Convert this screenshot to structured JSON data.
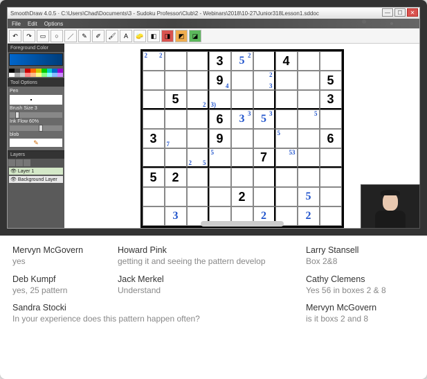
{
  "app": {
    "title": "SmoothDraw 4.0.5 · C:\\Users\\Chad\\Documents\\3 - Sudoku Professor\\Club\\2 - Webinars\\2018\\10-27\\Junior318Lesson1.sddoc",
    "menus": [
      "File",
      "Edit",
      "Options"
    ]
  },
  "window_buttons": {
    "min": "—",
    "max": "☐",
    "close": "✕"
  },
  "toolbar_icons": [
    "↶",
    "↷",
    "▭",
    "○",
    "／",
    "✎",
    "✐",
    "🖌",
    "A",
    "🧽",
    "◧",
    "◨",
    "◩",
    "◪"
  ],
  "sidepanel": {
    "foreground_label": "Foreground Color",
    "tool_options_label": "Tool Options",
    "pen_label": "Pen",
    "brush_size_label": "Brush Size",
    "brush_size_value": "3",
    "ink_flow_label": "Ink Flow",
    "ink_flow_value": "60%",
    "blob_label": "blob",
    "layers_label": "Layers",
    "layer1": "Layer 1",
    "layer_bg": "Background Layer"
  },
  "palette_colors": [
    "#000",
    "#444",
    "#888",
    "#c00",
    "#f60",
    "#cc0",
    "#0c0",
    "#0cc",
    "#06c",
    "#90c",
    "#fff",
    "#aaa",
    "#ccc",
    "#f88",
    "#fb8",
    "#ff8",
    "#8f8",
    "#8ff",
    "#8bf",
    "#c8f"
  ],
  "sudoku": {
    "givens": [
      [
        null,
        null,
        null,
        "3",
        null,
        null,
        "4",
        null,
        null
      ],
      [
        null,
        null,
        null,
        "9",
        null,
        null,
        null,
        null,
        "5"
      ],
      [
        null,
        "5",
        null,
        null,
        null,
        null,
        null,
        null,
        "3"
      ],
      [
        null,
        null,
        null,
        "6",
        null,
        null,
        null,
        null,
        null
      ],
      [
        "3",
        null,
        null,
        "9",
        null,
        null,
        null,
        null,
        "6"
      ],
      [
        null,
        null,
        null,
        null,
        null,
        "7",
        null,
        null,
        null
      ],
      [
        "5",
        "2",
        null,
        null,
        null,
        null,
        null,
        null,
        null
      ],
      [
        null,
        null,
        null,
        null,
        "2",
        null,
        null,
        null,
        null
      ],
      [
        null,
        null,
        null,
        null,
        null,
        null,
        null,
        null,
        null
      ]
    ],
    "pencils": {
      "0,0": [
        {
          "txt": "2",
          "pos": "tl"
        },
        {
          "txt": "2",
          "pos": "tr"
        }
      ],
      "0,4": [
        {
          "txt": "5",
          "pos": "c"
        },
        {
          "txt": "2",
          "pos": "tr"
        }
      ],
      "1,3": [
        {
          "txt": "4",
          "pos": "br"
        }
      ],
      "1,5": [
        {
          "txt": "2",
          "pos": "tr"
        },
        {
          "txt": "3",
          "pos": "br"
        }
      ],
      "2,2": [
        {
          "txt": "2",
          "pos": "br"
        }
      ],
      "2,3": [
        {
          "txt": "3)",
          "pos": "bl"
        }
      ],
      "3,4": [
        {
          "txt": "3",
          "pos": "c"
        },
        {
          "txt": "3",
          "pos": "tr"
        }
      ],
      "3,5": [
        {
          "txt": "5",
          "pos": "c"
        },
        {
          "txt": "3",
          "pos": "tr"
        }
      ],
      "3,7": [
        {
          "txt": "5",
          "pos": "tr"
        }
      ],
      "4,1": [
        {
          "txt": "7",
          "pos": "bl"
        }
      ],
      "4,6": [
        {
          "txt": "5",
          "pos": "tl"
        }
      ],
      "5,2": [
        {
          "txt": "5",
          "pos": "br"
        },
        {
          "txt": "2",
          "pos": "bl"
        }
      ],
      "5,6": [
        {
          "txt": "53",
          "pos": "tr"
        }
      ],
      "5,3": [
        {
          "txt": "5",
          "pos": "tl"
        }
      ],
      "7,7": [
        {
          "txt": "5",
          "pos": "c"
        }
      ],
      "8,1": [
        {
          "txt": "3",
          "pos": "c"
        }
      ],
      "8,5": [
        {
          "txt": "2",
          "pos": "c"
        }
      ],
      "8,7": [
        {
          "txt": "2",
          "pos": "c"
        }
      ]
    }
  },
  "chat": [
    {
      "name": "Mervyn McGovern",
      "msg": "yes",
      "col": 1
    },
    {
      "name": "Howard Pink",
      "msg": "getting it and seeing the pattern develop",
      "col": 2
    },
    {
      "name": "Larry Stansell",
      "msg": "Box 2&8",
      "col": 3
    },
    {
      "name": "Deb Kumpf",
      "msg": "yes, 25 pattern",
      "col": 1
    },
    {
      "name": "Jack Merkel",
      "msg": "Understand",
      "col": 2
    },
    {
      "name": "Cathy Clemens",
      "msg": "Yes 56 in boxes 2 & 8",
      "col": 3
    },
    {
      "name": "Sandra Stocki",
      "msg": "In your experience does this pattern happen often?",
      "col": 1,
      "span": 2
    },
    {
      "name": "Mervyn McGovern",
      "msg": "is it boxs 2 and 8",
      "col": 3
    }
  ]
}
